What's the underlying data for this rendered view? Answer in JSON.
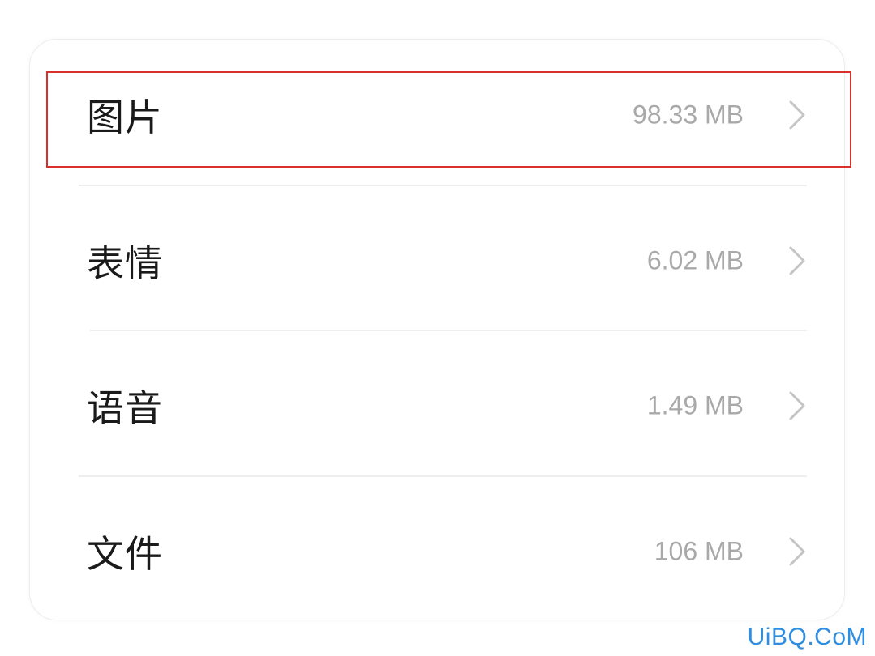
{
  "storage_list": {
    "items": [
      {
        "label": "图片",
        "size": "98.33 MB"
      },
      {
        "label": "表情",
        "size": "6.02 MB"
      },
      {
        "label": "语音",
        "size": "1.49 MB"
      },
      {
        "label": "文件",
        "size": "106 MB"
      }
    ]
  },
  "highlight": {
    "color": "#d9302c",
    "target": "图片"
  },
  "watermark": {
    "text": "UiBQ.CoM"
  },
  "icons": {
    "row_chevron": "chevron-right-icon"
  }
}
